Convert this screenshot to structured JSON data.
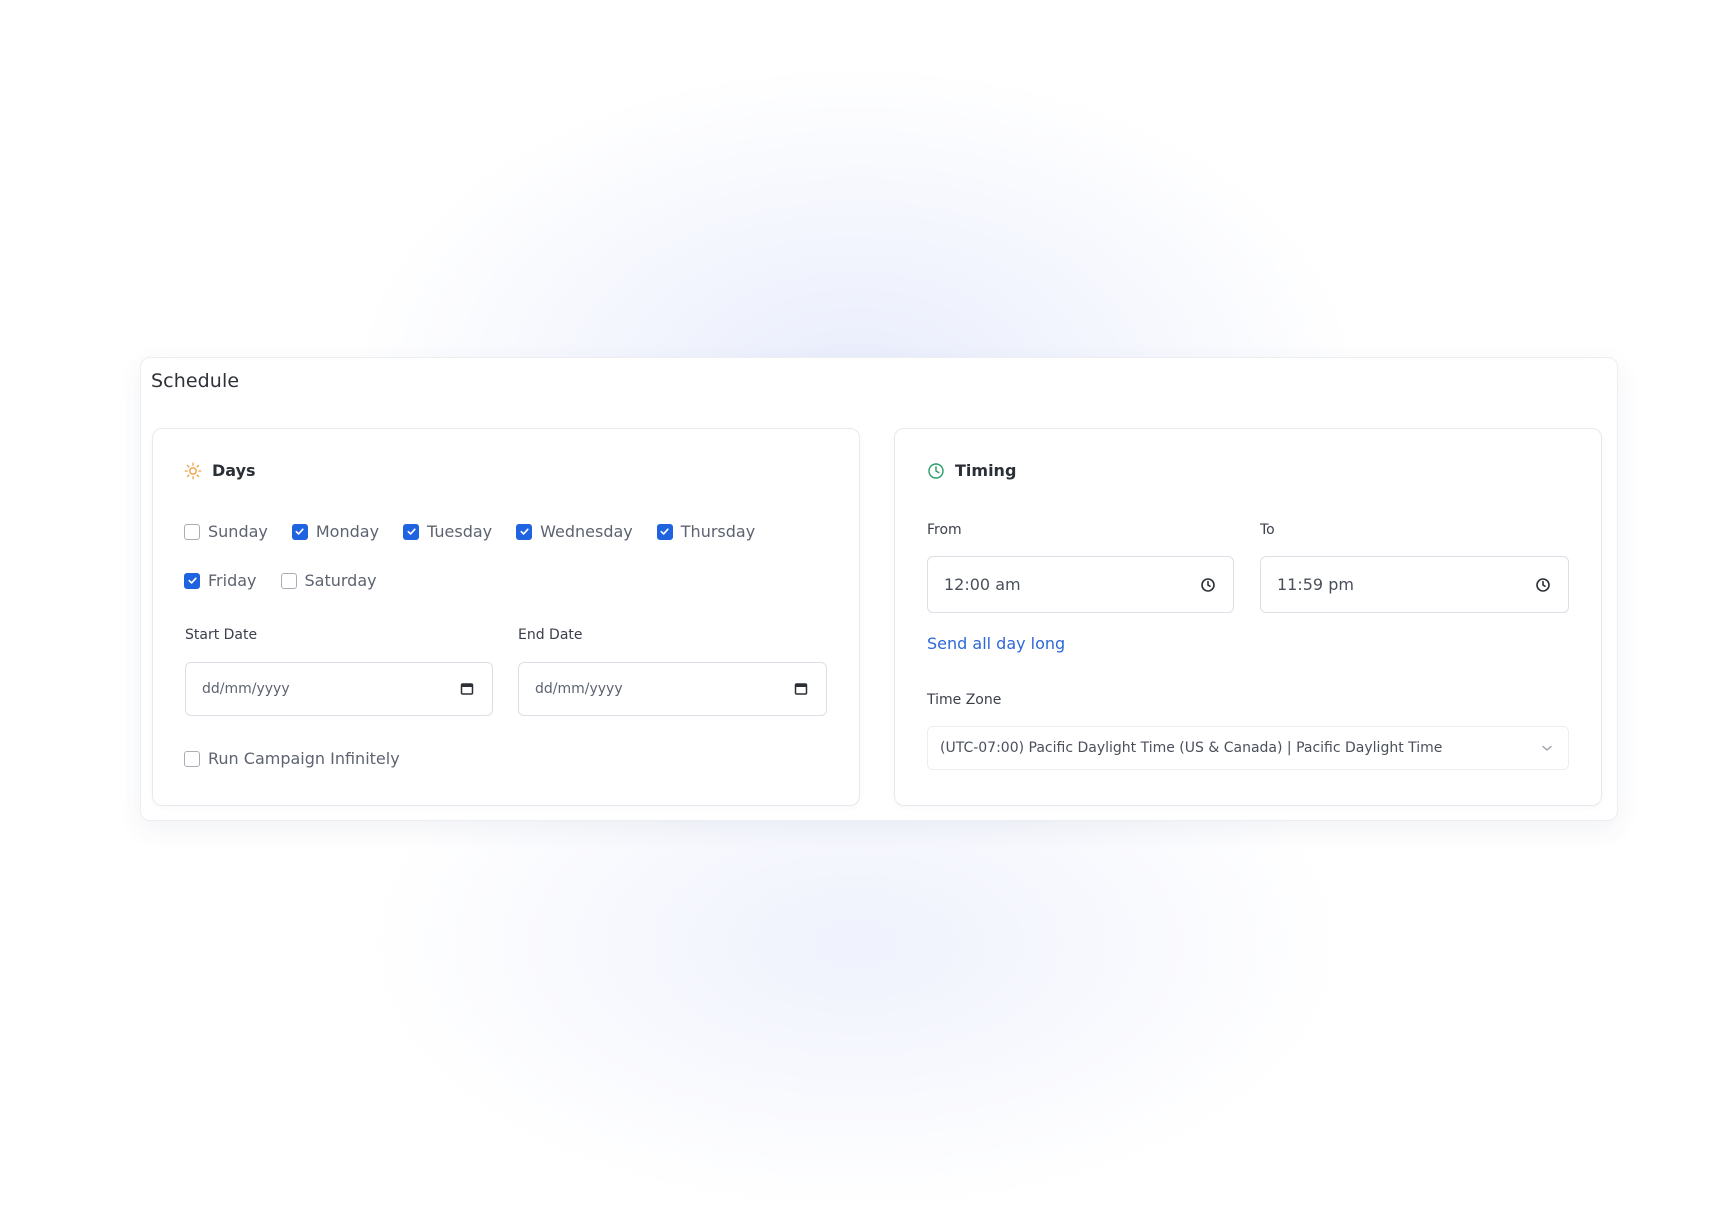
{
  "schedule": {
    "title": "Schedule",
    "days_panel": {
      "title": "Days",
      "icon": "sun-icon",
      "days": [
        {
          "label": "Sunday",
          "checked": false
        },
        {
          "label": "Monday",
          "checked": true
        },
        {
          "label": "Tuesday",
          "checked": true
        },
        {
          "label": "Wednesday",
          "checked": true
        },
        {
          "label": "Thursday",
          "checked": true
        },
        {
          "label": "Friday",
          "checked": true
        },
        {
          "label": "Saturday",
          "checked": false
        }
      ],
      "start_date": {
        "label": "Start Date",
        "placeholder": "dd/mm/yyyy"
      },
      "end_date": {
        "label": "End Date",
        "placeholder": "dd/mm/yyyy"
      },
      "run_infinitely": {
        "label": "Run Campaign Infinitely",
        "checked": false
      }
    },
    "timing_panel": {
      "title": "Timing",
      "icon": "clock-icon",
      "from": {
        "label": "From",
        "value": "12:00 am"
      },
      "to": {
        "label": "To",
        "value": "11:59 pm"
      },
      "send_all_day_link": "Send all day long",
      "time_zone": {
        "label": "Time Zone",
        "value": "(UTC-07:00) Pacific Daylight Time (US & Canada) | Pacific Daylight Time"
      }
    }
  },
  "colors": {
    "accent": "#1f63e0",
    "link": "#2c68d8",
    "sun_icon": "#f0a040",
    "clock_icon": "#2a9d6b"
  }
}
